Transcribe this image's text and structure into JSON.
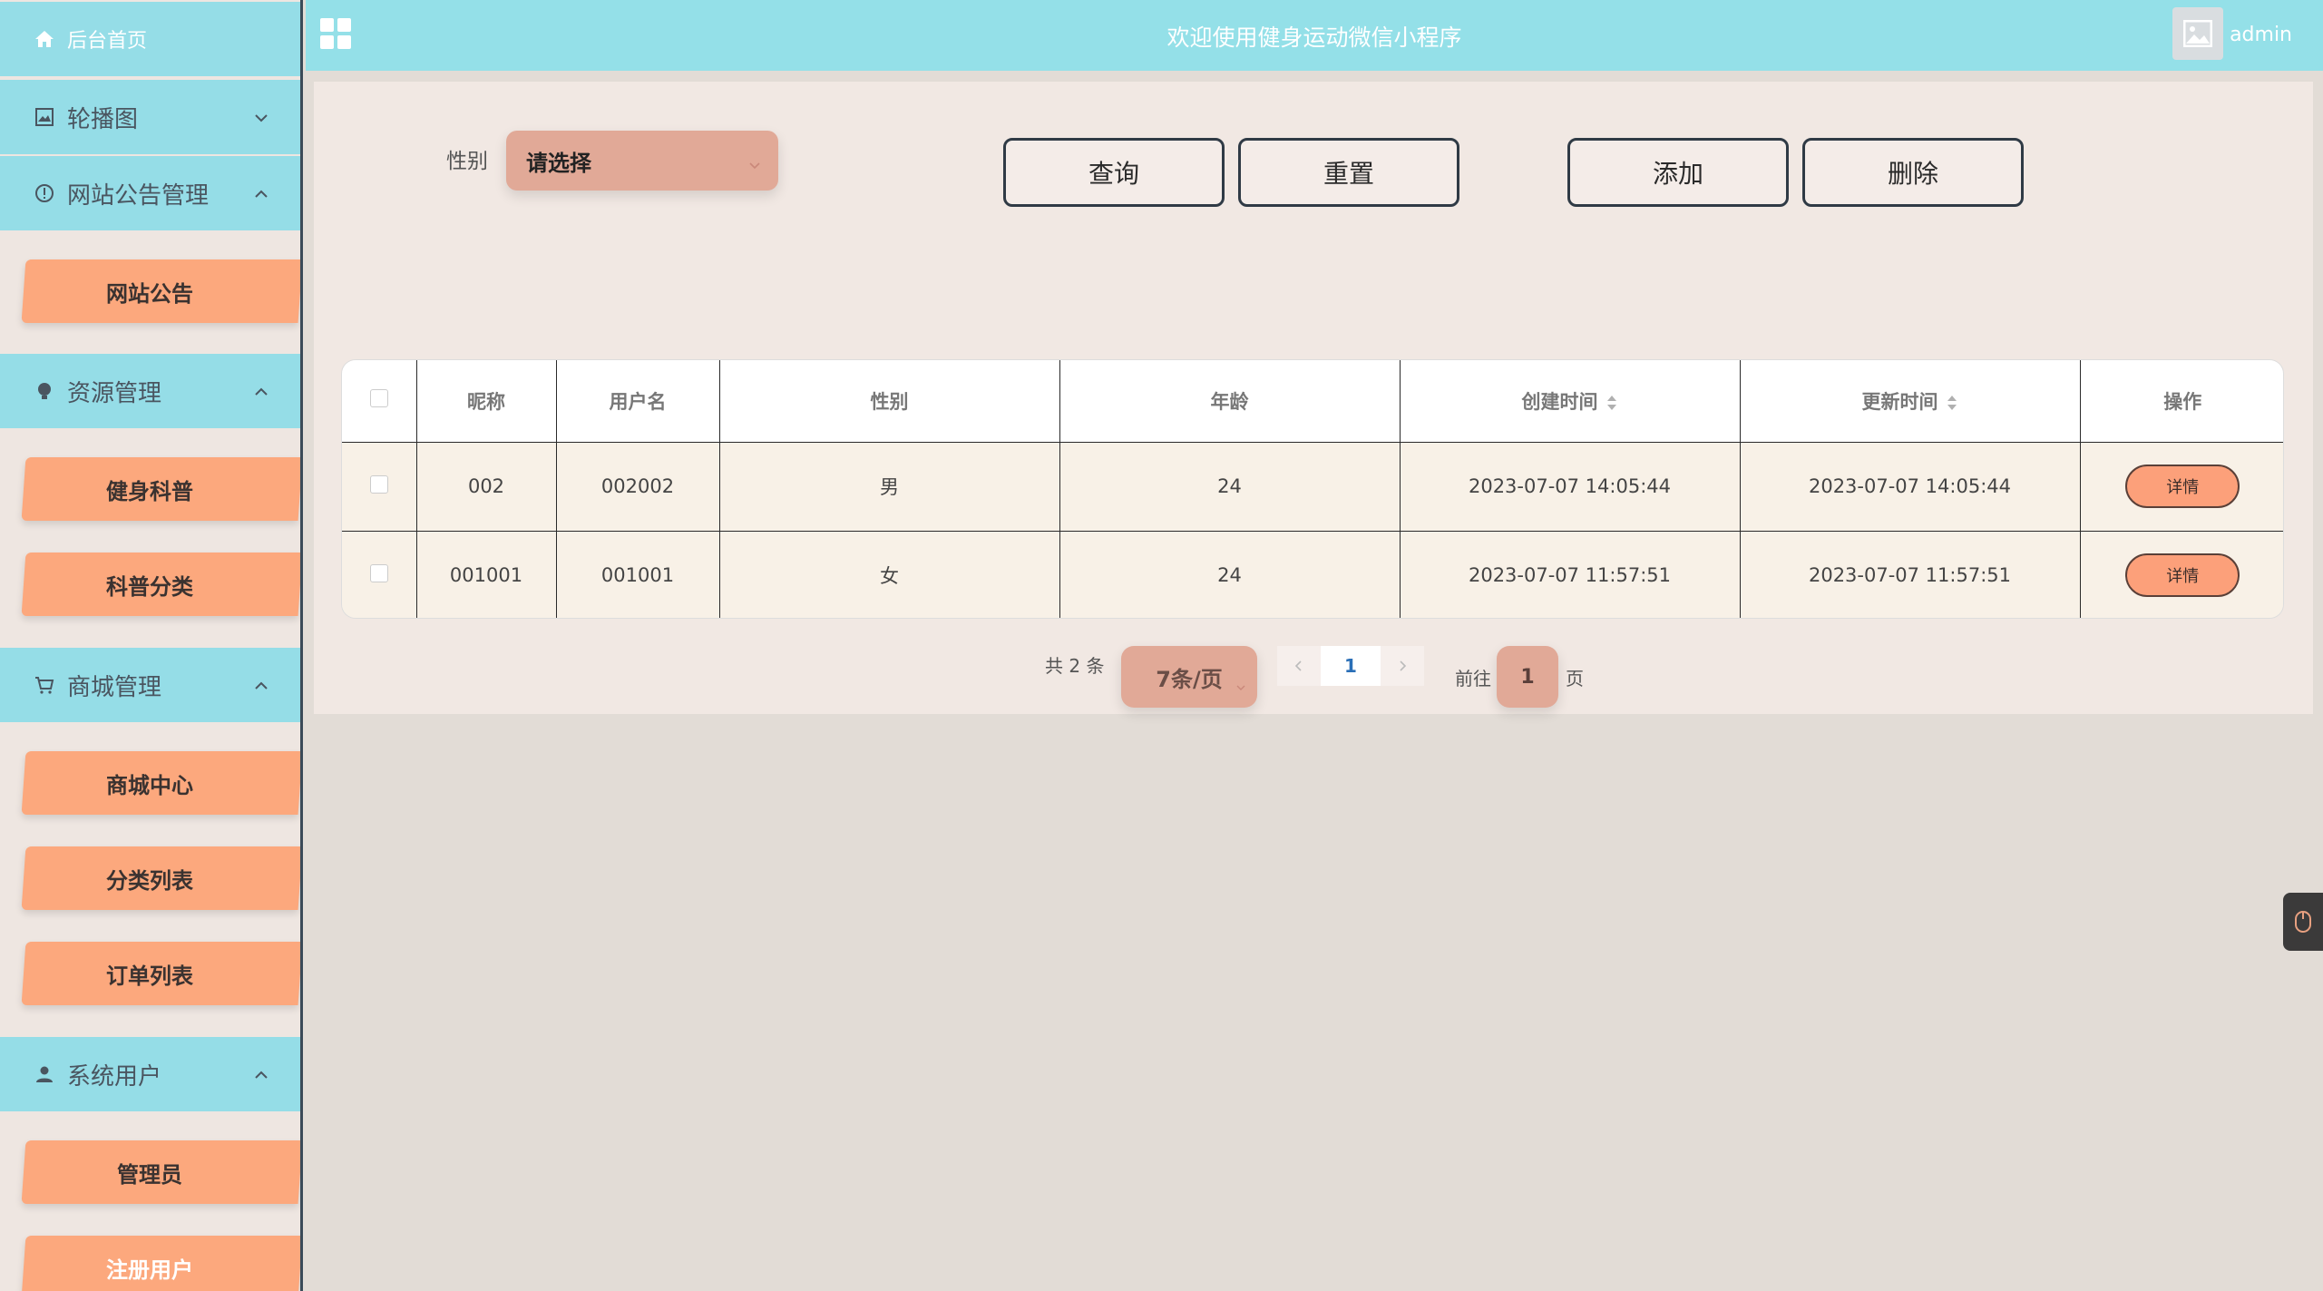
{
  "sidebar": {
    "home": "后台首页",
    "carousel": "轮播图",
    "notice_group": "网站公告管理",
    "notice_items": [
      "网站公告"
    ],
    "resource_group": "资源管理",
    "resource_items": [
      "健身科普",
      "科普分类"
    ],
    "mall_group": "商城管理",
    "mall_items": [
      "商城中心",
      "分类列表",
      "订单列表"
    ],
    "user_group": "系统用户",
    "user_items": [
      "管理员",
      "注册用户"
    ]
  },
  "header": {
    "title": "欢迎使用健身运动微信小程序",
    "user": "admin"
  },
  "filter": {
    "gender_label": "性别",
    "gender_placeholder": "请选择"
  },
  "toolbar": {
    "query": "查询",
    "reset": "重置",
    "add": "添加",
    "delete": "删除"
  },
  "table": {
    "columns": [
      "昵称",
      "用户名",
      "性别",
      "年龄",
      "创建时间",
      "更新时间",
      "操作"
    ],
    "rows": [
      {
        "nickname": "002",
        "username": "002002",
        "gender": "男",
        "age": "24",
        "created": "2023-07-07 14:05:44",
        "updated": "2023-07-07 14:05:44",
        "action": "详情"
      },
      {
        "nickname": "001001",
        "username": "001001",
        "gender": "女",
        "age": "24",
        "created": "2023-07-07 11:57:51",
        "updated": "2023-07-07 11:57:51",
        "action": "详情"
      }
    ]
  },
  "pagination": {
    "total": "共 2 条",
    "page_size": "7条/页",
    "current_page": "1",
    "goto_label": "前往",
    "goto_value": "1",
    "goto_unit": "页"
  },
  "colors": {
    "menu_head": "#95dde7",
    "sub_item": "#fca87d",
    "header": "#94e0e8",
    "accent_select": "#e1a997",
    "detail_button": "#fca07a"
  }
}
